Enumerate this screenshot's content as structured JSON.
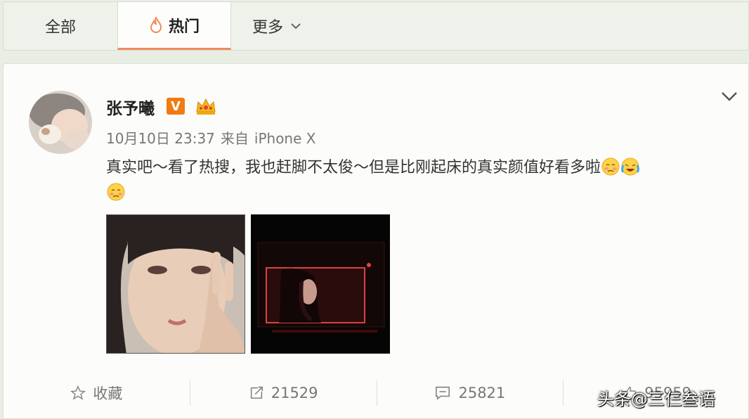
{
  "tabs": {
    "all": "全部",
    "hot": "热门",
    "more": "更多"
  },
  "post": {
    "username": "张予曦",
    "verified_badge": "V",
    "date": "10月10日 23:37",
    "from": "来自",
    "device": "iPhone X",
    "text_main": "真实吧～看了热搜，我也赶脚不太俊～但是比刚起床的真实颜值好看多啦",
    "emojis": [
      "shy-face-emoji",
      "laughing-crying-emoji",
      "shy-face-emoji"
    ],
    "images": [
      "selfie-photo",
      "film-monitor-photo"
    ]
  },
  "actions": {
    "favorite": "收藏",
    "repost_count": "21529",
    "comment_count": "25821",
    "like_count": "95959"
  },
  "watermark": "头条@三仨叁语",
  "colors": {
    "accent": "#f08a5d",
    "badge": "#f07a14"
  }
}
